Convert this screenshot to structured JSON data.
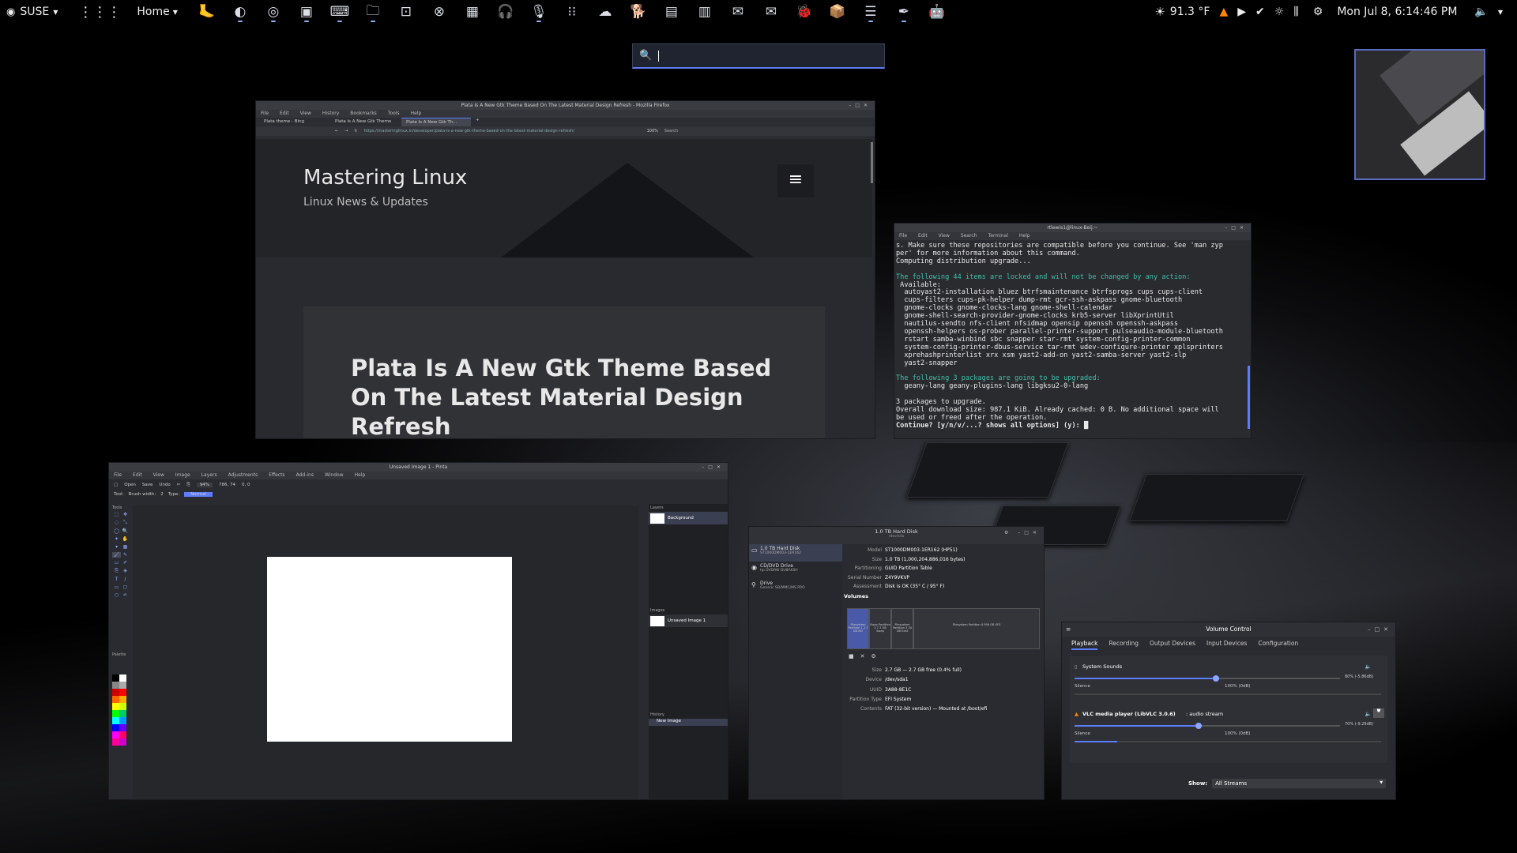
{
  "topbar": {
    "distro": "SUSE",
    "home_label": "Home",
    "weather": "91.3 °F",
    "datetime": "Mon Jul 8, 6:14:46 PM",
    "app_icons": [
      "gnome-foot-icon",
      "firefox-icon",
      "chrome-icon",
      "monitor-icon",
      "terminal-icon",
      "files-icon",
      "screenshot-icon",
      "close-circle-icon",
      "radio-icon",
      "headphones-icon",
      "microphone-icon",
      "grid-icon",
      "cloud-icon",
      "gimp-icon",
      "notes-icon",
      "document-icon",
      "mail-icon",
      "envelope-icon",
      "bug-icon",
      "package-icon",
      "list-icon",
      "inkscape-icon",
      "robot-icon"
    ]
  },
  "search": {
    "value": ""
  },
  "firefox": {
    "title": "Plata Is A New Gtk Theme Based On The Latest Material Design Refresh - Mozilla Firefox",
    "menu": [
      "File",
      "Edit",
      "View",
      "History",
      "Bookmarks",
      "Tools",
      "Help"
    ],
    "tabs": [
      "Plata theme - Bing",
      "Plata Is A New Gtk Theme",
      "Plata Is A New Gtk Th..."
    ],
    "url": "https://masteringlinux.in/developer/plata-is-a-new-gtk-theme-based-on-the-latest-material-design-refresh/",
    "zoom": "100%",
    "search_placeholder": "Search",
    "site_title": "Mastering Linux",
    "site_tagline": "Linux News & Updates",
    "article_title": "Plata Is A New Gtk Theme Based On The Latest Material Design Refresh"
  },
  "terminal": {
    "title": "rtlewis1@linux-Beij:~",
    "menu": [
      "File",
      "Edit",
      "View",
      "Search",
      "Terminal",
      "Help"
    ],
    "lines": [
      {
        "t": "s. Make sure these repositories are compatible before you continue. See 'man zyp",
        "c": ""
      },
      {
        "t": "per' for more information about this command.",
        "c": ""
      },
      {
        "t": "Computing distribution upgrade...",
        "c": ""
      },
      {
        "t": "",
        "c": ""
      },
      {
        "t": "The following 44 items are locked and will not be changed by any action:",
        "c": "g"
      },
      {
        "t": " Available:",
        "c": ""
      },
      {
        "t": "  autoyast2-installation bluez btrfsmaintenance btrfsprogs cups cups-client",
        "c": ""
      },
      {
        "t": "  cups-filters cups-pk-helper dump-rmt gcr-ssh-askpass gnome-bluetooth",
        "c": ""
      },
      {
        "t": "  gnome-clocks gnome-clocks-lang gnome-shell-calendar",
        "c": ""
      },
      {
        "t": "  gnome-shell-search-provider-gnome-clocks krb5-server libXprintUtil",
        "c": ""
      },
      {
        "t": "  nautilus-sendto nfs-client nfsidmap opensip openssh openssh-askpass",
        "c": ""
      },
      {
        "t": "  openssh-helpers os-prober parallel-printer-support pulseaudio-module-bluetooth",
        "c": ""
      },
      {
        "t": "  rstart samba-winbind sbc snapper star-rmt system-config-printer-common",
        "c": ""
      },
      {
        "t": "  system-config-printer-dbus-service tar-rmt udev-configure-printer xplsprinters",
        "c": ""
      },
      {
        "t": "  xprehashprinterlist xrx xsm yast2-add-on yast2-samba-server yast2-slp",
        "c": ""
      },
      {
        "t": "  yast2-snapper",
        "c": ""
      },
      {
        "t": "",
        "c": ""
      },
      {
        "t": "The following 3 packages are going to be upgraded:",
        "c": "g"
      },
      {
        "t": "  geany-lang geany-plugins-lang libgksu2-0-lang",
        "c": ""
      },
      {
        "t": "",
        "c": ""
      },
      {
        "t": "3 packages to upgrade.",
        "c": ""
      },
      {
        "t": "Overall download size: 987.1 KiB. Already cached: 0 B. No additional space will",
        "c": ""
      },
      {
        "t": "be used or freed after the operation.",
        "c": ""
      },
      {
        "t": "Continue? [y/n/v/...? shows all options] (y): █",
        "c": "b"
      }
    ]
  },
  "pinta": {
    "title": "Unsaved Image 1 - Pinta",
    "menu": [
      "File",
      "Edit",
      "View",
      "Image",
      "Layers",
      "Adjustments",
      "Effects",
      "Add-ins",
      "Window",
      "Help"
    ],
    "toolbar": {
      "open": "Open",
      "save": "Save",
      "undo": "Undo",
      "zoom": "94%",
      "coords": "786, 74",
      "size": "0, 0"
    },
    "toolrow": {
      "tool": "Tool:",
      "brush_width_label": "Brush width:",
      "brush_width": "2",
      "type_label": "Type:",
      "type_value": "Normal"
    },
    "tools_label": "Tools",
    "palette_label": "Palette",
    "layers_label": "Layers",
    "layer_name": "Background",
    "images_label": "Images",
    "image_name": "Unsaved Image 1",
    "history_label": "History",
    "history_item": "New Image"
  },
  "disks": {
    "title": "1.0 TB Hard Disk",
    "subtitle": "/dev/sda",
    "devices": [
      {
        "name": "1.0 TB Hard Disk",
        "sub": "ST1000DM003-1ER162"
      },
      {
        "name": "CD/DVD Drive",
        "sub": "hp    DVDRW DU8A6SH"
      },
      {
        "name": "Drive",
        "sub": "Generic SD/MMC/MS PRO"
      }
    ],
    "info": [
      {
        "k": "Model",
        "v": "ST1000DM003-1ER162 (HP51)"
      },
      {
        "k": "Size",
        "v": "1.0 TB (1,000,204,886,016 bytes)"
      },
      {
        "k": "Partitioning",
        "v": "GUID Partition Table"
      },
      {
        "k": "Serial Number",
        "v": "Z4Y9VKVP"
      },
      {
        "k": "Assessment",
        "v": "Disk is OK (35° C / 95° F)"
      }
    ],
    "volumes_label": "Volumes",
    "partitions": [
      "Filesystem Partition 1 2.7 GB FAT",
      "Swap Partition 2 7.7 GB Swap",
      "Filesystem Partition 3 34 GB Ext4",
      "Filesystem Partition 4 956 GB XFS"
    ],
    "vol_info": [
      {
        "k": "Size",
        "v": "2.7 GB — 2.7 GB free (0.4% full)"
      },
      {
        "k": "Device",
        "v": "/dev/sda1"
      },
      {
        "k": "UUID",
        "v": "3A88-8E1C"
      },
      {
        "k": "Partition Type",
        "v": "EFI System"
      },
      {
        "k": "Contents",
        "v": "FAT (32-bit version) — Mounted at /boot/efi"
      }
    ]
  },
  "volume": {
    "title": "Volume Control",
    "tabs": [
      "Playback",
      "Recording",
      "Output Devices",
      "Input Devices",
      "Configuration"
    ],
    "streams": [
      {
        "name": "System Sounds",
        "level_text": "80% (-5.86dB)",
        "left": "Silence",
        "center": "100% (0dB)",
        "level": 0.8
      },
      {
        "name": "VLC media player (LibVLC 3.0.6)",
        "suffix": ": audio stream",
        "level_text": "70% (-9.29dB)",
        "left": "Silence",
        "center": "100% (0dB)",
        "level": 0.7
      }
    ],
    "show_label": "Show:",
    "show_value": "All Streams"
  },
  "colors": {
    "accent": "#5c7cfa",
    "terminal_green": "#3fbfa8"
  }
}
